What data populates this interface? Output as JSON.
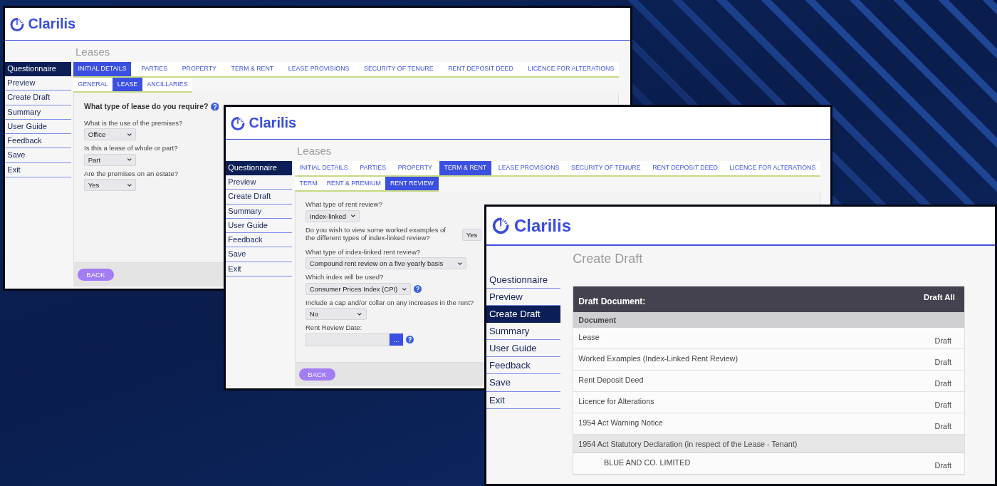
{
  "windows": [
    {
      "kind": "questionnaire",
      "logo": "Clarilis",
      "page_title": "Leases",
      "sidebar": [
        {
          "label": "Questionnaire",
          "selected": true
        },
        {
          "label": "Preview",
          "selected": false
        },
        {
          "label": "Create Draft",
          "selected": false
        },
        {
          "label": "Summary",
          "selected": false
        },
        {
          "label": "User Guide",
          "selected": false
        },
        {
          "label": "Feedback",
          "selected": false
        },
        {
          "label": "Save",
          "selected": false
        },
        {
          "label": "Exit",
          "selected": false
        }
      ],
      "tabs": [
        {
          "label": "INITIAL DETAILS",
          "selected": true
        },
        {
          "label": "PARTIES",
          "selected": false
        },
        {
          "label": "PROPERTY",
          "selected": false
        },
        {
          "label": "TERM & RENT",
          "selected": false
        },
        {
          "label": "LEASE PROVISIONS",
          "selected": false
        },
        {
          "label": "SECURITY OF TENURE",
          "selected": false
        },
        {
          "label": "RENT DEPOSIT DEED",
          "selected": false
        },
        {
          "label": "LICENCE FOR ALTERATIONS",
          "selected": false
        }
      ],
      "subtabs": [
        {
          "label": "GENERAL",
          "selected": false
        },
        {
          "label": "LEASE",
          "selected": true
        },
        {
          "label": "ANCILLARIES",
          "selected": false
        }
      ],
      "questions": [
        {
          "kind": "heading",
          "label": "What type of lease do you require?",
          "help": true
        },
        {
          "kind": "select",
          "label": "What is the use of the premises?",
          "value": "Office",
          "help": false
        },
        {
          "kind": "select",
          "label": "Is this a lease of whole or part?",
          "value": "Part",
          "help": false
        },
        {
          "kind": "select",
          "label": "Are the premises on an estate?",
          "value": "Yes",
          "help": false
        }
      ],
      "back_button": "BACK"
    },
    {
      "kind": "questionnaire",
      "logo": "Clarilis",
      "page_title": "Leases",
      "sidebar": [
        {
          "label": "Questionnaire",
          "selected": true
        },
        {
          "label": "Preview",
          "selected": false
        },
        {
          "label": "Create Draft",
          "selected": false
        },
        {
          "label": "Summary",
          "selected": false
        },
        {
          "label": "User Guide",
          "selected": false
        },
        {
          "label": "Feedback",
          "selected": false
        },
        {
          "label": "Save",
          "selected": false
        },
        {
          "label": "Exit",
          "selected": false
        }
      ],
      "tabs": [
        {
          "label": "INITIAL DETAILS",
          "selected": false
        },
        {
          "label": "PARTIES",
          "selected": false
        },
        {
          "label": "PROPERTY",
          "selected": false
        },
        {
          "label": "TERM & RENT",
          "selected": true
        },
        {
          "label": "LEASE PROVISIONS",
          "selected": false
        },
        {
          "label": "SECURITY OF TENURE",
          "selected": false
        },
        {
          "label": "RENT DEPOSIT DEED",
          "selected": false
        },
        {
          "label": "LICENCE FOR ALTERATIONS",
          "selected": false
        }
      ],
      "subtabs": [
        {
          "label": "TERM",
          "selected": false
        },
        {
          "label": "RENT & PREMIUM",
          "selected": false
        },
        {
          "label": "RENT REVIEW",
          "selected": true
        }
      ],
      "questions": [
        {
          "kind": "select",
          "label": "What type of rent review?",
          "value": "Index-linked",
          "help": false
        },
        {
          "kind": "inline-select",
          "label": "Do you wish to view some worked examples of the different types of index-linked review?",
          "value": "Yes",
          "help": false
        },
        {
          "kind": "select",
          "label": "What type of index-linked rent review?",
          "value": "Compound rent review on a five-yearly basis",
          "help": false
        },
        {
          "kind": "select",
          "label": "Which index will be used?",
          "value": "Consumer Prices Index (CPI)",
          "help": true
        },
        {
          "kind": "select",
          "label": "Include a cap and/or collar on any increases in the rent?",
          "value": "No",
          "help": false
        },
        {
          "kind": "date",
          "label": "Rent Review Date:",
          "button": "...",
          "help": true
        }
      ],
      "back_button": "BACK"
    },
    {
      "kind": "drafts",
      "logo": "Clarilis",
      "page_title": "Create Draft",
      "sidebar": [
        {
          "label": "Questionnaire",
          "selected": false
        },
        {
          "label": "Preview",
          "selected": false
        },
        {
          "label": "Create Draft",
          "selected": true
        },
        {
          "label": "Summary",
          "selected": false
        },
        {
          "label": "User Guide",
          "selected": false
        },
        {
          "label": "Feedback",
          "selected": false
        },
        {
          "label": "Save",
          "selected": false
        },
        {
          "label": "Exit",
          "selected": false
        }
      ],
      "table": {
        "title": "Draft Document:",
        "action": "Draft All",
        "column": "Document",
        "rows": [
          {
            "kind": "document",
            "name": "Lease",
            "action": "Draft"
          },
          {
            "kind": "document",
            "name": "Worked Examples (Index-Linked Rent Review)",
            "action": "Draft"
          },
          {
            "kind": "document",
            "name": "Rent Deposit Deed",
            "action": "Draft"
          },
          {
            "kind": "document",
            "name": "Licence for Alterations",
            "action": "Draft"
          },
          {
            "kind": "document",
            "name": "1954 Act Warning Notice",
            "action": "Draft"
          },
          {
            "kind": "group",
            "name": "1954 Act Statutory Declaration (in respect of the Lease - Tenant)"
          },
          {
            "kind": "party",
            "name": "BLUE AND CO. LIMITED",
            "action": "Draft"
          }
        ]
      }
    }
  ]
}
